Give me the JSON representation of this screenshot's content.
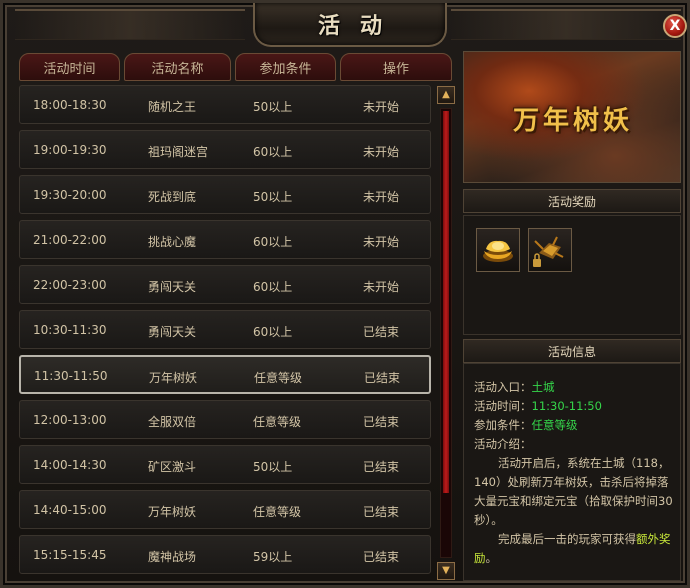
{
  "window": {
    "title": "活动",
    "close_label": "X"
  },
  "table": {
    "headers": [
      "活动时间",
      "活动名称",
      "参加条件",
      "操作"
    ],
    "rows": [
      {
        "time": "18:00-18:30",
        "name": "随机之王",
        "condition": "50以上",
        "status": "未开始"
      },
      {
        "time": "19:00-19:30",
        "name": "祖玛阁迷宫",
        "condition": "60以上",
        "status": "未开始"
      },
      {
        "time": "19:30-20:00",
        "name": "死战到底",
        "condition": "50以上",
        "status": "未开始"
      },
      {
        "time": "21:00-22:00",
        "name": "挑战心魔",
        "condition": "60以上",
        "status": "未开始"
      },
      {
        "time": "22:00-23:00",
        "name": "勇闯天关",
        "condition": "60以上",
        "status": "未开始"
      },
      {
        "time": "10:30-11:30",
        "name": "勇闯天关",
        "condition": "60以上",
        "status": "已结束"
      },
      {
        "time": "11:30-11:50",
        "name": "万年树妖",
        "condition": "任意等级",
        "status": "已结束"
      },
      {
        "time": "12:00-13:00",
        "name": "全服双倍",
        "condition": "任意等级",
        "status": "已结束"
      },
      {
        "time": "14:00-14:30",
        "name": "矿区激斗",
        "condition": "50以上",
        "status": "已结束"
      },
      {
        "time": "14:40-15:00",
        "name": "万年树妖",
        "condition": "任意等级",
        "status": "已结束"
      },
      {
        "time": "15:15-15:45",
        "name": "魔神战场",
        "condition": "59以上",
        "status": "已结束"
      }
    ],
    "selected_index": 6
  },
  "scrollbar": {
    "up_glyph": "▲",
    "down_glyph": "▼"
  },
  "detail": {
    "banner_title": "万年树妖",
    "reward_header": "活动奖励",
    "info_header": "活动信息",
    "entry_label": "活动入口：",
    "entry_value": "土城",
    "time_label": "活动时间：",
    "time_value": "11:30-11:50",
    "cond_label": "参加条件：",
    "cond_value": "任意等级",
    "intro_label": "活动介绍：",
    "intro_p1": "活动开启后，系统在土城（118，140）处刷新万年树妖，击杀后将掉落大量元宝和绑定元宝（拾取保护时间30秒）。",
    "intro_p2_a": "完成最后一击的玩家可获得",
    "intro_p2_b": "额外奖励",
    "intro_p2_c": "。"
  },
  "colors": {
    "accent_green": "#35d54a",
    "accent_gold": "#f1c04a",
    "header_red": "#4a1716"
  }
}
